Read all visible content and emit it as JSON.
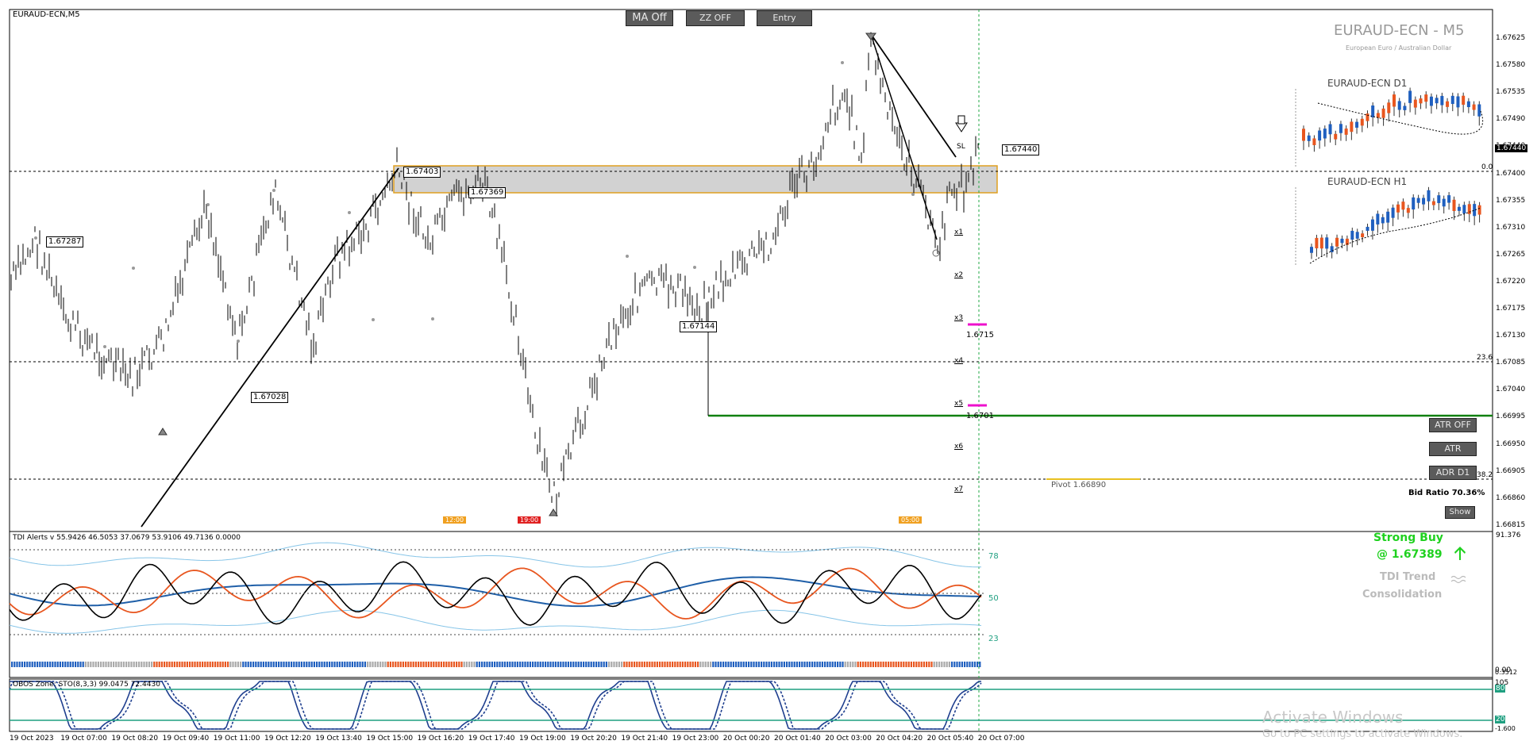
{
  "symbol_tag": "EURAUD-ECN,M5",
  "watermark": {
    "title": "EURAUD-ECN - M5",
    "subtitle": "European Euro / Australian Dollar"
  },
  "buttons": {
    "ma": "MA Off",
    "zz": "ZZ OFF",
    "entry": "Entry"
  },
  "right_buttons": {
    "atr_off": "ATR OFF",
    "atr": "ATR",
    "adr": "ADR D1",
    "show": "Show"
  },
  "bid_ratio": "Bid Ratio 70.36%",
  "mini_charts": [
    {
      "title": "EURAUD-ECN D1"
    },
    {
      "title": "EURAUD-ECN H1"
    }
  ],
  "price_axis": [
    "1.67625",
    "1.67580",
    "1.67535",
    "1.67490",
    "1.67440",
    "1.67400",
    "1.67355",
    "1.67310",
    "1.67265",
    "1.67220",
    "1.67175",
    "1.67130",
    "1.67085",
    "1.67040",
    "1.66995",
    "1.66950",
    "1.66905",
    "1.66860",
    "1.66815"
  ],
  "price_labels": {
    "p1": "1.67287",
    "p2": "1.67403",
    "p3": "1.67369",
    "p4": "1.67028",
    "p5": "1.67144",
    "p6": "1.67440",
    "p7": "1.6715",
    "p8": "1.6701"
  },
  "levels": {
    "lvl236": "23.6",
    "lvl382": "38.2",
    "lvl00": "0.0",
    "pivot": "Pivot 1.66890"
  },
  "x_marks": [
    "x1",
    "x2",
    "x3",
    "x4",
    "x5",
    "x6",
    "x7"
  ],
  "session_tags": {
    "t1": "12:00",
    "t2": "19:00",
    "t3": "05:00"
  },
  "sl_label": "SL",
  "tdi": {
    "header": "TDI Alerts v 55.9426 46.5053 37.0679 53.9106 49.7136 0.0000",
    "axis": "91.376",
    "l78": "78",
    "l50": "50",
    "l23": "23",
    "signal": "Strong Buy",
    "signal_price": "@ 1.67389",
    "trend": "TDI Trend",
    "trend_state": "Consolidation",
    "bottom_axis": "0.00"
  },
  "obos": {
    "header": "OBOS Zone:   STO(8,3,3)  99.0475 72.4430",
    "top": "105",
    "l80": "80",
    "l20": "20",
    "bottom": "-1.600",
    "bottom_axis": "0.3512"
  },
  "time_axis": [
    "19 Oct 2023",
    "19 Oct 07:00",
    "19 Oct 08:20",
    "19 Oct 09:40",
    "19 Oct 11:00",
    "19 Oct 12:20",
    "19 Oct 13:40",
    "19 Oct 15:00",
    "19 Oct 16:20",
    "19 Oct 17:40",
    "19 Oct 19:00",
    "19 Oct 20:20",
    "19 Oct 21:40",
    "19 Oct 23:00",
    "20 Oct 00:20",
    "20 Oct 01:40",
    "20 Oct 03:00",
    "20 Oct 04:20",
    "20 Oct 05:40",
    "20 Oct 07:00"
  ],
  "activation": {
    "line1": "Activate Windows",
    "line2": "Go to PC settings to activate Windows."
  },
  "colors": {
    "bull": "#1f5fbf",
    "bear": "#e8561f",
    "tdi_green": "#1fd11f",
    "magenta": "#ee11cc",
    "zone_border": "#e0a020",
    "band": "#87c5e8",
    "green_line": "#108010"
  }
}
